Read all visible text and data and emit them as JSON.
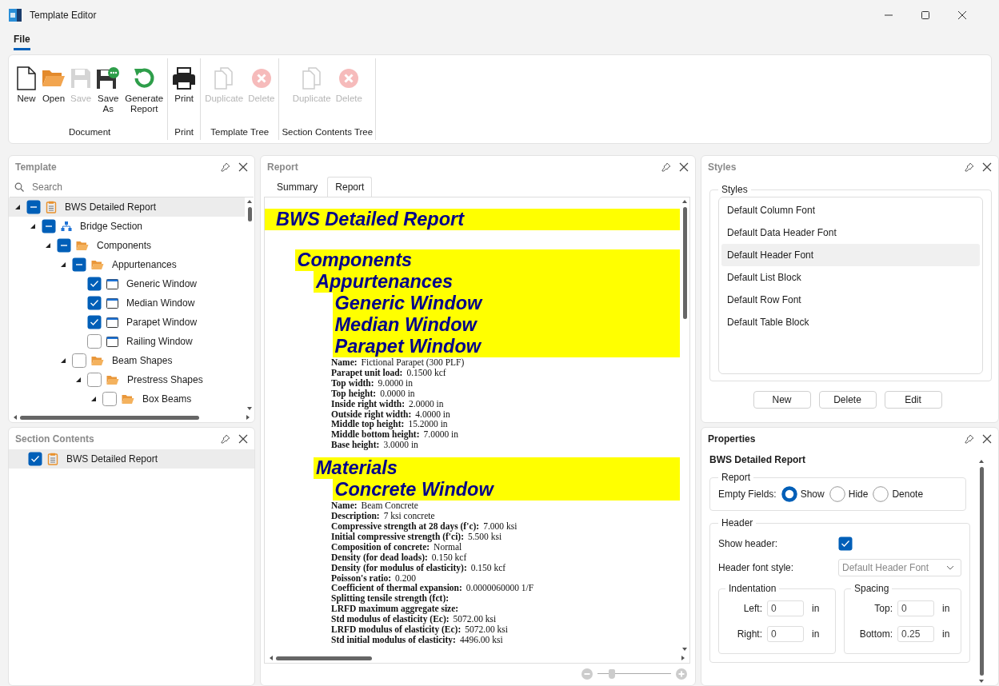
{
  "window": {
    "title": "Template Editor"
  },
  "menu": [
    {
      "label": "File",
      "selected": true
    }
  ],
  "ribbon": [
    {
      "label": "Document",
      "buttons": [
        {
          "label": "New",
          "kind": "new",
          "disabled": false
        },
        {
          "label": "Open",
          "kind": "open",
          "disabled": false
        },
        {
          "label": "Save",
          "kind": "save",
          "disabled": true
        },
        {
          "label": "Save As",
          "kind": "save_as",
          "disabled": false
        },
        {
          "label": "Generate Report",
          "kind": "generate",
          "disabled": false
        }
      ]
    },
    {
      "label": "Print",
      "buttons": [
        {
          "label": "Print",
          "kind": "print",
          "disabled": false
        }
      ]
    },
    {
      "label": "Template Tree",
      "buttons": [
        {
          "label": "Duplicate",
          "kind": "duplicate",
          "disabled": true
        },
        {
          "label": "Delete",
          "kind": "delete",
          "disabled": true
        }
      ]
    },
    {
      "label": "Section Contents Tree",
      "buttons": [
        {
          "label": "Duplicate",
          "kind": "duplicate",
          "disabled": true
        },
        {
          "label": "Delete",
          "kind": "delete",
          "disabled": true
        }
      ]
    }
  ],
  "template": {
    "title": "Template",
    "search": {
      "placeholder": "Search"
    },
    "tree": [
      {
        "label": "BWS Detailed Report",
        "kind": "report",
        "indeterminate": true,
        "expanded": true,
        "selected": true,
        "children": [
          {
            "label": "Bridge Section",
            "kind": "section",
            "indeterminate": true,
            "expanded": true,
            "selected": false,
            "children": [
              {
                "label": "Components",
                "kind": "folder",
                "indeterminate": true,
                "expanded": true,
                "selected": false,
                "children": [
                  {
                    "label": "Appurtenances",
                    "kind": "folder",
                    "indeterminate": true,
                    "expanded": true,
                    "selected": false,
                    "children": [
                      {
                        "label": "Generic Window",
                        "kind": "window",
                        "checked": true,
                        "indeterminate": false,
                        "selected": false
                      },
                      {
                        "label": "Median Window",
                        "kind": "window",
                        "checked": true,
                        "indeterminate": false,
                        "selected": false
                      },
                      {
                        "label": "Parapet Window",
                        "kind": "window",
                        "checked": true,
                        "indeterminate": false,
                        "selected": false
                      },
                      {
                        "label": "Railing Window",
                        "kind": "window",
                        "checked": false,
                        "indeterminate": false,
                        "selected": false
                      }
                    ]
                  },
                  {
                    "label": "Beam Shapes",
                    "kind": "folder",
                    "checked": false,
                    "indeterminate": false,
                    "expanded": true,
                    "selected": false,
                    "children": [
                      {
                        "label": "Prestress Shapes",
                        "kind": "folder",
                        "checked": false,
                        "indeterminate": false,
                        "expanded": true,
                        "selected": false,
                        "children": [
                          {
                            "label": "Box Beams",
                            "kind": "folder",
                            "checked": false,
                            "indeterminate": false,
                            "expanded": true,
                            "selected": false
                          }
                        ]
                      }
                    ]
                  }
                ]
              }
            ]
          }
        ]
      }
    ]
  },
  "section_contents": {
    "title": "Section Contents",
    "items": [
      {
        "label": "BWS Detailed Report",
        "kind": "report",
        "checked": true,
        "selected": true
      }
    ]
  },
  "report": {
    "title": "Report",
    "tabs": [
      {
        "label": "Summary",
        "selected": false
      },
      {
        "label": "Report",
        "selected": true
      }
    ],
    "document": [
      {
        "kind": "heading",
        "text": "BWS Detailed Report",
        "children": [
          {
            "kind": "heading",
            "text": "Components",
            "children": [
              {
                "kind": "heading",
                "text": "Appurtenances",
                "children": [
                  {
                    "kind": "heading",
                    "text": "Generic Window"
                  },
                  {
                    "kind": "heading",
                    "text": "Median Window"
                  },
                  {
                    "kind": "heading",
                    "text": "Parapet Window",
                    "children": [
                      {
                        "kind": "field",
                        "label": "Name:",
                        "value": "Fictional Parapet (300 PLF)"
                      },
                      {
                        "kind": "field",
                        "label": "Parapet unit load:",
                        "value": "0.1500 kcf"
                      },
                      {
                        "kind": "field",
                        "label": "Top width:",
                        "value": "9.0000 in"
                      },
                      {
                        "kind": "field",
                        "label": "Top height:",
                        "value": "0.0000 in"
                      },
                      {
                        "kind": "field",
                        "label": "Inside right width:",
                        "value": "2.0000 in"
                      },
                      {
                        "kind": "field",
                        "label": "Outside right width:",
                        "value": "4.0000 in"
                      },
                      {
                        "kind": "field",
                        "label": "Middle top height:",
                        "value": "15.2000 in"
                      },
                      {
                        "kind": "field",
                        "label": "Middle bottom height:",
                        "value": "7.0000 in"
                      },
                      {
                        "kind": "field",
                        "label": "Base height:",
                        "value": "3.0000 in"
                      }
                    ]
                  }
                ]
              },
              {
                "kind": "heading",
                "text": "Materials",
                "children": [
                  {
                    "kind": "heading",
                    "text": "Concrete Window",
                    "children": [
                      {
                        "kind": "field",
                        "label": "Name:",
                        "value": "Beam Concrete"
                      },
                      {
                        "kind": "field",
                        "label": "Description:",
                        "value": "7 ksi concrete"
                      },
                      {
                        "kind": "field",
                        "label": "Compressive strength at 28 days (f'c):",
                        "value": "7.000 ksi"
                      },
                      {
                        "kind": "field",
                        "label": "Initial compressive strength (f'ci):",
                        "value": "5.500 ksi"
                      },
                      {
                        "kind": "field",
                        "label": "Composition of concrete:",
                        "value": "Normal"
                      },
                      {
                        "kind": "field",
                        "label": "Density (for dead loads):",
                        "value": "0.150 kcf"
                      },
                      {
                        "kind": "field",
                        "label": "Density (for modulus of elasticity):",
                        "value": "0.150 kcf"
                      },
                      {
                        "kind": "field",
                        "label": "Poisson's ratio:",
                        "value": "0.200"
                      },
                      {
                        "kind": "field",
                        "label": "Coefficient of thermal expansion:",
                        "value": "0.0000060000 1/F"
                      },
                      {
                        "kind": "field",
                        "label": "Splitting tensile strength (fct):"
                      },
                      {
                        "kind": "field",
                        "label": "LRFD maximum aggregate size:"
                      },
                      {
                        "kind": "field",
                        "label": "Std modulus of elasticity (Ec):",
                        "value": "5072.00 ksi"
                      },
                      {
                        "kind": "field",
                        "label": "LRFD modulus of elasticity (Ec):",
                        "value": "5072.00 ksi"
                      },
                      {
                        "kind": "field",
                        "label": "Std initial modulus of elasticity:",
                        "value": "4496.00 ksi"
                      }
                    ]
                  }
                ]
              }
            ]
          }
        ]
      }
    ],
    "zoom": {
      "level": 0.2
    }
  },
  "styles": {
    "title": "Styles",
    "group": "Styles",
    "items": [
      {
        "label": "Default Column Font",
        "selected": false
      },
      {
        "label": "Default Data Header Font",
        "selected": false
      },
      {
        "label": "Default Header Font",
        "selected": true
      },
      {
        "label": "Default List Block",
        "selected": false
      },
      {
        "label": "Default Row Font",
        "selected": false
      },
      {
        "label": "Default Table Block",
        "selected": false
      }
    ],
    "buttons": [
      "New",
      "Delete",
      "Edit"
    ]
  },
  "properties": {
    "title": "Properties",
    "heading": "BWS Detailed Report",
    "report_group": {
      "title": "Report",
      "label": "Empty Fields:",
      "options": [
        {
          "label": "Show",
          "selected": true
        },
        {
          "label": "Hide",
          "selected": false
        },
        {
          "label": "Denote",
          "selected": false
        }
      ]
    },
    "header_group": {
      "title": "Header",
      "show_header": {
        "label": "Show header:",
        "checked": true
      },
      "font_style": {
        "label": "Header font style:",
        "value": "Default Header Font",
        "disabled": true
      },
      "indentation": {
        "title": "Indentation",
        "fields": [
          {
            "label": "Left:",
            "value": "0",
            "unit": "in"
          },
          {
            "label": "Right:",
            "value": "0",
            "unit": "in"
          }
        ]
      },
      "spacing": {
        "title": "Spacing",
        "fields": [
          {
            "label": "Top:",
            "value": "0",
            "unit": "in"
          },
          {
            "label": "Bottom:",
            "value": "0.25",
            "unit": "in"
          }
        ]
      }
    }
  }
}
